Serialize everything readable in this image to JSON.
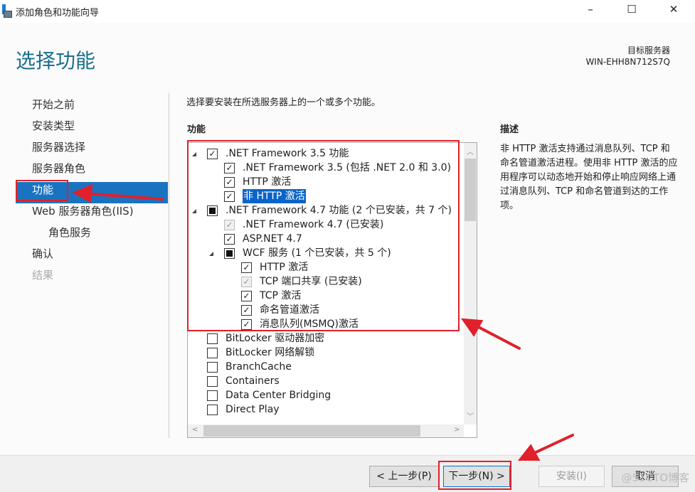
{
  "window": {
    "title": "添加角色和功能向导",
    "controls": {
      "minimize": "–",
      "maximize": "☐",
      "close": "✕"
    }
  },
  "page": {
    "heading": "选择功能",
    "target_label": "目标服务器",
    "target_server": "WIN-EHH8N712S7Q"
  },
  "nav": [
    {
      "label": "开始之前",
      "state": "normal"
    },
    {
      "label": "安装类型",
      "state": "normal"
    },
    {
      "label": "服务器选择",
      "state": "normal"
    },
    {
      "label": "服务器角色",
      "state": "normal"
    },
    {
      "label": "功能",
      "state": "active"
    },
    {
      "label": "Web 服务器角色(IIS)",
      "state": "normal"
    },
    {
      "label": "角色服务",
      "state": "sub"
    },
    {
      "label": "确认",
      "state": "normal"
    },
    {
      "label": "结果",
      "state": "disabled"
    }
  ],
  "main": {
    "intro": "选择要安装在所选服务器上的一个或多个功能。",
    "features_label": "功能",
    "description_label": "描述",
    "description": "非 HTTP 激活支持通过消息队列、TCP 和命名管道激活进程。使用非 HTTP 激活的应用程序可以动态地开始和停止响应网络上通过消息队列、TCP 和命名管道到达的工作项。"
  },
  "features": [
    {
      "label": ".NET Framework 3.5 功能",
      "level": 0,
      "expander": true,
      "state": "checked"
    },
    {
      "label": ".NET Framework 3.5 (包括 .NET 2.0 和 3.0)",
      "level": 1,
      "state": "checked"
    },
    {
      "label": "HTTP 激活",
      "level": 1,
      "state": "checked"
    },
    {
      "label": "非 HTTP 激活",
      "level": 1,
      "state": "checked",
      "selected": true
    },
    {
      "label": ".NET Framework 4.7 功能 (2 个已安装，共 7 个)",
      "level": 0,
      "expander": true,
      "state": "partial"
    },
    {
      "label": ".NET Framework 4.7 (已安装)",
      "level": 1,
      "state": "installed"
    },
    {
      "label": "ASP.NET 4.7",
      "level": 1,
      "state": "checked"
    },
    {
      "label": "WCF 服务 (1 个已安装，共 5 个)",
      "level": 1,
      "expander": true,
      "state": "partial"
    },
    {
      "label": "HTTP 激活",
      "level": 2,
      "state": "checked"
    },
    {
      "label": "TCP 端口共享 (已安装)",
      "level": 2,
      "state": "installed"
    },
    {
      "label": "TCP 激活",
      "level": 2,
      "state": "checked"
    },
    {
      "label": "命名管道激活",
      "level": 2,
      "state": "checked"
    },
    {
      "label": "消息队列(MSMQ)激活",
      "level": 2,
      "state": "checked"
    },
    {
      "label": "BitLocker 驱动器加密",
      "level": 0,
      "state": "unchecked"
    },
    {
      "label": "BitLocker 网络解锁",
      "level": 0,
      "state": "unchecked"
    },
    {
      "label": "BranchCache",
      "level": 0,
      "state": "unchecked"
    },
    {
      "label": "Containers",
      "level": 0,
      "state": "unchecked"
    },
    {
      "label": "Data Center Bridging",
      "level": 0,
      "state": "unchecked"
    },
    {
      "label": "Direct Play",
      "level": 0,
      "state": "unchecked"
    }
  ],
  "buttons": {
    "prev": "< 上一步(P)",
    "next": "下一步(N) >",
    "install": "安装(I)",
    "cancel": "取消"
  },
  "watermark": "@51CTO博客",
  "colors": {
    "accent": "#1a73c0",
    "heading": "#1a6e8e",
    "annotation": "#e0202a"
  }
}
